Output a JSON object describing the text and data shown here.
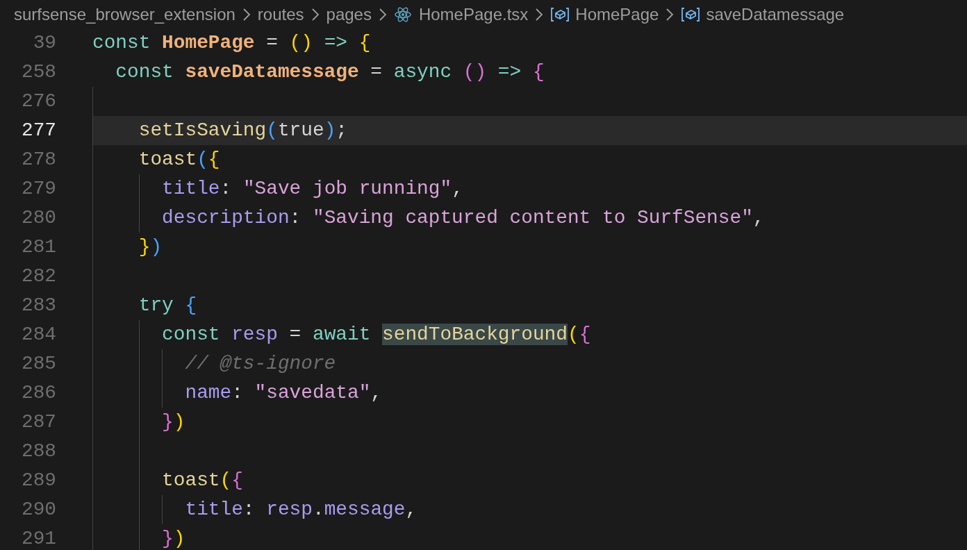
{
  "breadcrumbs": [
    {
      "label": "surfsense_browser_extension",
      "kind": "folder"
    },
    {
      "label": "routes",
      "kind": "folder"
    },
    {
      "label": "pages",
      "kind": "folder"
    },
    {
      "label": "HomePage.tsx",
      "kind": "file"
    },
    {
      "label": "HomePage",
      "kind": "symbol"
    },
    {
      "label": "saveDatamessage",
      "kind": "symbol"
    }
  ],
  "lines": [
    {
      "number": "39",
      "current": false,
      "tokens": [
        {
          "kind": "keyword",
          "text": "const "
        },
        {
          "kind": "definition",
          "text": "HomePage"
        },
        {
          "kind": "punctuation",
          "text": " = "
        },
        {
          "kind": "bracket",
          "color": "#ffd700",
          "text": "()"
        },
        {
          "kind": "keyword",
          "text": " => "
        },
        {
          "kind": "bracket",
          "color": "#ffd700",
          "text": "{"
        }
      ]
    },
    {
      "number": "258",
      "current": false,
      "tokens": [
        {
          "kind": "keyword",
          "text": "  const "
        },
        {
          "kind": "definition",
          "text": "saveDatamessage"
        },
        {
          "kind": "punctuation",
          "text": " = "
        },
        {
          "kind": "keyword",
          "text": "async "
        },
        {
          "kind": "bracket",
          "color": "#da70d6",
          "text": "()"
        },
        {
          "kind": "keyword",
          "text": " => "
        },
        {
          "kind": "bracket",
          "color": "#da70d6",
          "text": "{"
        }
      ]
    },
    {
      "number": "276",
      "current": false
    },
    {
      "number": "277",
      "current": true,
      "tokens": [
        {
          "kind": "function",
          "text": "    setIsSaving"
        },
        {
          "kind": "bracket",
          "color": "#4aa3ff",
          "text": "("
        },
        {
          "kind": "literal",
          "text": "true"
        },
        {
          "kind": "bracket",
          "color": "#4aa3ff",
          "text": ")"
        },
        {
          "kind": "punctuation",
          "text": ";"
        }
      ]
    },
    {
      "number": "278",
      "current": false,
      "tokens": [
        {
          "kind": "function",
          "text": "    toast"
        },
        {
          "kind": "bracket",
          "color": "#4aa3ff",
          "text": "("
        },
        {
          "kind": "bracket",
          "color": "#ffd700",
          "text": "{"
        }
      ]
    },
    {
      "number": "279",
      "current": false,
      "tokens": [
        {
          "kind": "property",
          "text": "      title"
        },
        {
          "kind": "punctuation",
          "text": ": "
        },
        {
          "kind": "string",
          "text": "\"Save job running\""
        },
        {
          "kind": "punctuation",
          "text": ","
        }
      ]
    },
    {
      "number": "280",
      "current": false,
      "tokens": [
        {
          "kind": "property",
          "text": "      description"
        },
        {
          "kind": "punctuation",
          "text": ": "
        },
        {
          "kind": "string",
          "text": "\"Saving captured content to SurfSense\""
        },
        {
          "kind": "punctuation",
          "text": ","
        }
      ]
    },
    {
      "number": "281",
      "current": false,
      "tokens": [
        {
          "kind": "bracket",
          "color": "#ffd700",
          "text": "    }"
        },
        {
          "kind": "bracket",
          "color": "#4aa3ff",
          "text": ")"
        }
      ]
    },
    {
      "number": "282",
      "current": false
    },
    {
      "number": "283",
      "current": false,
      "tokens": [
        {
          "kind": "keyword",
          "text": "    try "
        },
        {
          "kind": "bracket",
          "color": "#4aa3ff",
          "text": "{"
        }
      ]
    },
    {
      "number": "284",
      "current": false,
      "tokens": [
        {
          "kind": "keyword",
          "text": "      const "
        },
        {
          "kind": "variable",
          "text": "resp"
        },
        {
          "kind": "punctuation",
          "text": " = "
        },
        {
          "kind": "keyword",
          "text": "await "
        },
        {
          "kind": "match",
          "text": "sendToBackground"
        },
        {
          "kind": "bracket",
          "color": "#ffd700",
          "text": "("
        },
        {
          "kind": "bracket",
          "color": "#da70d6",
          "text": "{"
        }
      ]
    },
    {
      "number": "285",
      "current": false,
      "tokens": [
        {
          "kind": "comment",
          "text": "        // @ts-ignore"
        }
      ]
    },
    {
      "number": "286",
      "current": false,
      "tokens": [
        {
          "kind": "property",
          "text": "        name"
        },
        {
          "kind": "punctuation",
          "text": ": "
        },
        {
          "kind": "string",
          "text": "\"savedata\""
        },
        {
          "kind": "punctuation",
          "text": ","
        }
      ]
    },
    {
      "number": "287",
      "current": false,
      "tokens": [
        {
          "kind": "bracket",
          "color": "#da70d6",
          "text": "      }"
        },
        {
          "kind": "bracket",
          "color": "#ffd700",
          "text": ")"
        }
      ]
    },
    {
      "number": "288",
      "current": false
    },
    {
      "number": "289",
      "current": false,
      "tokens": [
        {
          "kind": "function",
          "text": "      toast"
        },
        {
          "kind": "bracket",
          "color": "#ffd700",
          "text": "("
        },
        {
          "kind": "bracket",
          "color": "#da70d6",
          "text": "{"
        }
      ]
    },
    {
      "number": "290",
      "current": false,
      "tokens": [
        {
          "kind": "property",
          "text": "        title"
        },
        {
          "kind": "punctuation",
          "text": ": "
        },
        {
          "kind": "variable",
          "text": "resp"
        },
        {
          "kind": "punctuation",
          "text": "."
        },
        {
          "kind": "property",
          "text": "message"
        },
        {
          "kind": "punctuation",
          "text": ","
        }
      ]
    },
    {
      "number": "291",
      "current": false,
      "tokens": [
        {
          "kind": "bracket",
          "color": "#da70d6",
          "text": "      }"
        },
        {
          "kind": "bracket",
          "color": "#ffd700",
          "text": ")"
        }
      ]
    }
  ]
}
